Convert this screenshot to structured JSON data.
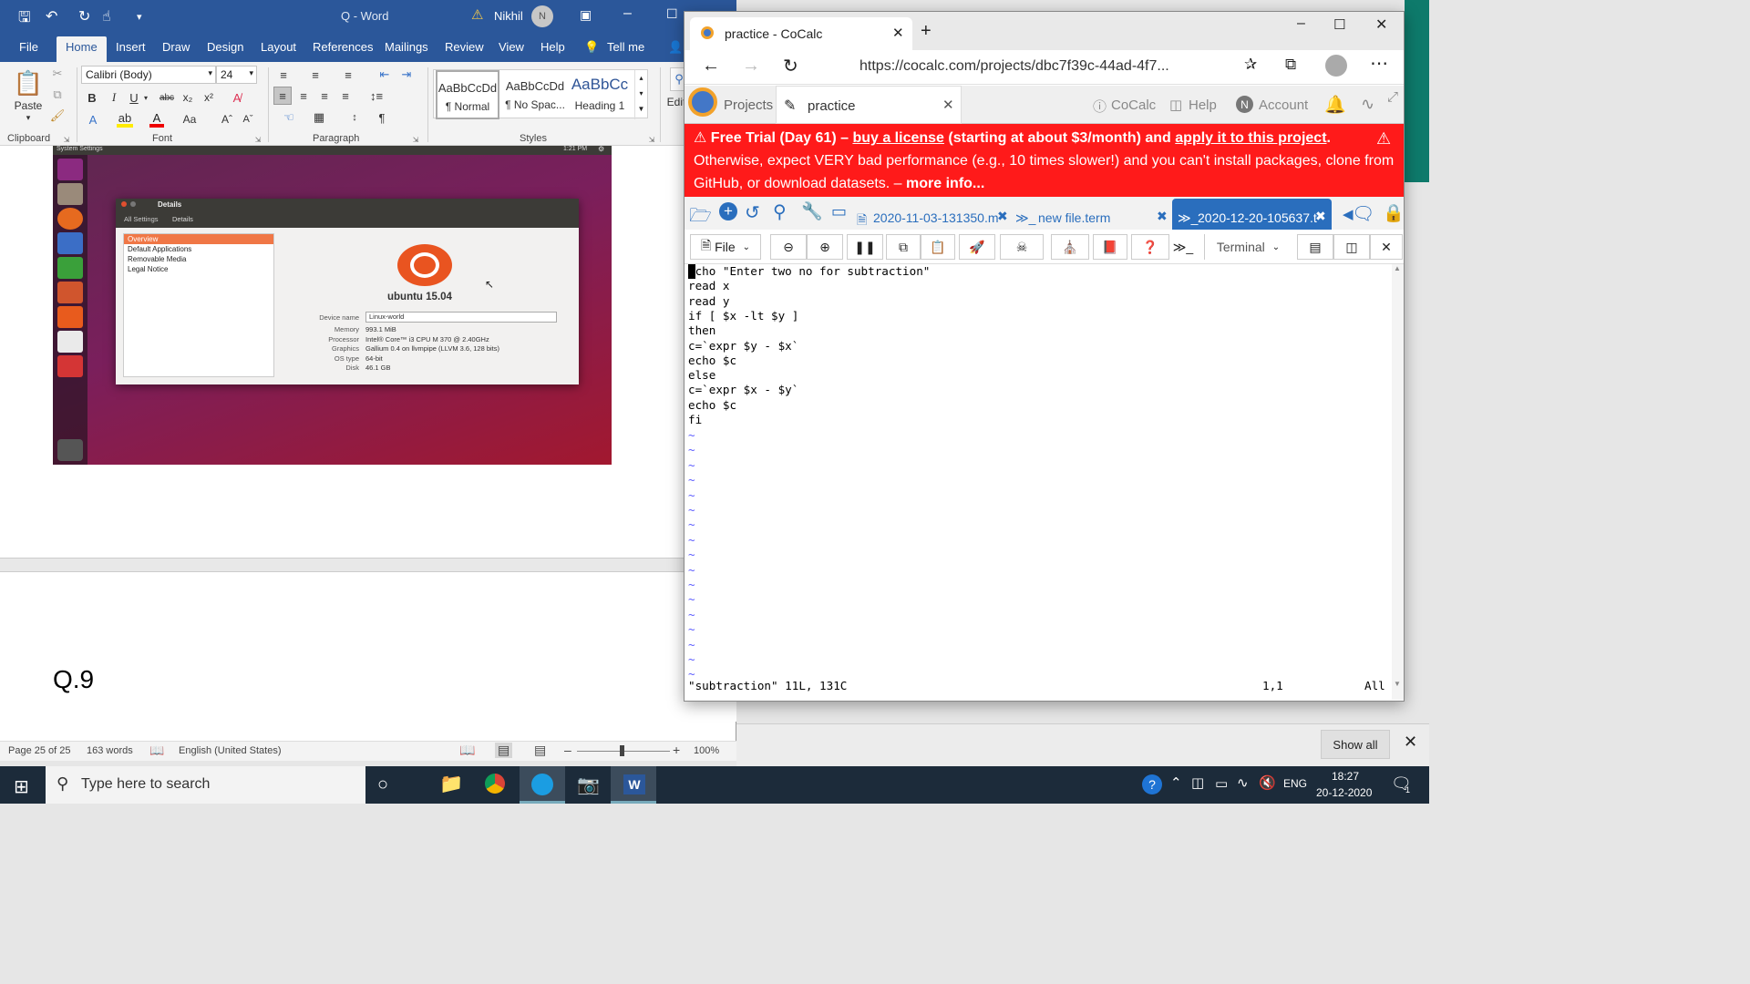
{
  "word": {
    "title": "Q  -  Word",
    "user": "Nikhil",
    "user_initial": "N",
    "menu": [
      "File",
      "Home",
      "Insert",
      "Draw",
      "Design",
      "Layout",
      "References",
      "Mailings",
      "Review",
      "View",
      "Help",
      "Tell me"
    ],
    "font_name": "Calibri (Body)",
    "font_size": "24",
    "paste": "Paste",
    "edit": "Edit",
    "groups": {
      "clipboard": "Clipboard",
      "font": "Font",
      "paragraph": "Paragraph",
      "styles": "Styles"
    },
    "styles": [
      {
        "preview": "AaBbCcDd",
        "name": "¶ Normal"
      },
      {
        "preview": "AaBbCcDd",
        "name": "¶ No Spac..."
      },
      {
        "preview": "AaBbCc",
        "name": "Heading 1"
      }
    ],
    "doc_heading": "Q.9",
    "status": {
      "page": "Page 25 of 25",
      "words": "163 words",
      "lang": "English (United States)",
      "zoom": "100%"
    },
    "screenshot": {
      "topbar_title": "System Settings",
      "topbar_time": "1:21 PM",
      "window_title": "Details",
      "crumbs": [
        "All Settings",
        "Details"
      ],
      "list": [
        "Overview",
        "Default Applications",
        "Removable Media",
        "Legal Notice"
      ],
      "distro": "ubuntu 15.04",
      "device_label": "Device name",
      "device_value": "Linux-world",
      "specs": [
        {
          "k": "Memory",
          "v": "993.1 MiB"
        },
        {
          "k": "Processor",
          "v": "Intel® Core™ i3 CPU M 370 @ 2.40GHz"
        },
        {
          "k": "Graphics",
          "v": "Gallium 0.4 on llvmpipe (LLVM 3.6, 128 bits)"
        },
        {
          "k": "OS type",
          "v": "64-bit"
        },
        {
          "k": "Disk",
          "v": "46.1 GB"
        }
      ]
    }
  },
  "edge": {
    "tab_title": "practice - CoCalc",
    "url": "https://cocalc.com/projects/dbc7f39c-44ad-4f7...",
    "cocalc": {
      "projects": "Projects",
      "file": "practice",
      "brand": "CoCalc",
      "help": "Help",
      "account": "Account",
      "account_initial": "N"
    },
    "banner": {
      "a": "Free Trial (Day 61)",
      "b": " – ",
      "c": "buy a license",
      "d": " (starting at about $3/month) and ",
      "e": "apply it to this project",
      "f": ".",
      "g": "Otherwise, expect VERY bad performance (e.g., 10 times slower!) and you can't install packages, clone from GitHub, or download datasets. – ",
      "h": "more info..."
    },
    "file_tabs": [
      "2020-11-03-131350.m",
      "new file.term",
      "2020-12-20-105637.t"
    ],
    "toolbar": {
      "file": "File",
      "terminal": "Terminal"
    },
    "code": [
      "echo \"Enter two no for subtraction\"",
      "read x",
      "read y",
      "if [ $x -lt $y ]",
      "then",
      "c=`expr $y - $x`",
      "echo $c",
      "else",
      "c=`expr $x - $y`",
      "echo $c",
      "fi"
    ],
    "tilde": "~",
    "status_left": "\"subtraction\" 11L, 131C",
    "status_pos": "1,1",
    "status_all": "All"
  },
  "taskbar": {
    "search": "Type here to search",
    "lang": "ENG",
    "time": "18:27",
    "date": "20-12-2020",
    "show_all": "Show all",
    "notif": "1"
  }
}
